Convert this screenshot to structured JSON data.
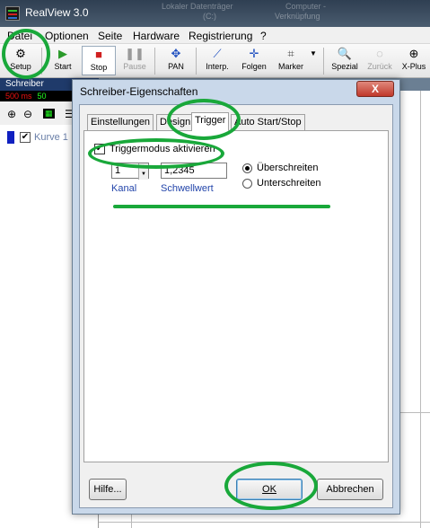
{
  "app": {
    "title": "RealView 3.0",
    "ghost_tabs": [
      "Lokaler Datenträger",
      "(C:)",
      "Computer -",
      "Verknüpfung"
    ]
  },
  "menu": [
    "Datei",
    "Optionen",
    "Seite",
    "Hardware",
    "Registrierung",
    "?"
  ],
  "toolbar": {
    "setup": "Setup",
    "start": "Start",
    "stop": "Stop",
    "pause": "Pause",
    "pan": "PAN",
    "interp": "Interp.",
    "folgen": "Folgen",
    "marker": "Marker",
    "spezial": "Spezial",
    "zurueck": "Zurück",
    "xplus": "X-Plus"
  },
  "side": {
    "header": "Schreiber",
    "status_rate": "500 ms",
    "status_green": "50",
    "curve_label": "Kurve 1"
  },
  "dialog": {
    "title": "Schreiber-Eigenschaften",
    "close": "X",
    "tabs": [
      "Einstellungen",
      "Design",
      "Trigger",
      "Auto Start/Stop"
    ],
    "active_tab": "Trigger",
    "trigger_enable_label": "Triggermodus aktivieren",
    "trigger_enabled": true,
    "channel_value": "1",
    "channel_label": "Kanal",
    "threshold_value": "1,2345",
    "threshold_label": "Schwellwert",
    "radio_above": "Überschreiten",
    "radio_below": "Unterschreiten",
    "selected_radio": "Überschreiten",
    "help_button": "Hilfe...",
    "ok_button": "OK",
    "cancel_button": "Abbrechen"
  },
  "colors": {
    "highlight": "#19a83a",
    "curve": "#1020c0"
  }
}
